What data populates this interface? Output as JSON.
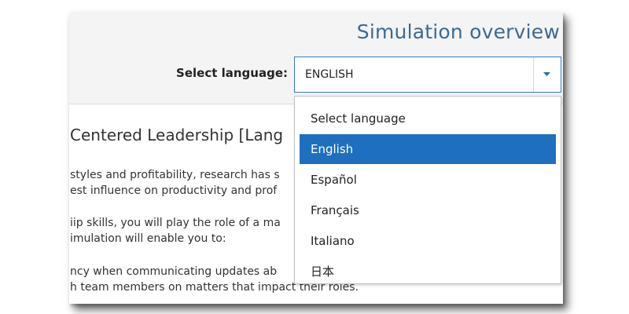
{
  "header": {
    "title": "Simulation overview",
    "language_label": "Select language:",
    "language_value": "ENGLISH"
  },
  "content": {
    "title": "Centered Leadership [Lang",
    "paragraphs": [
      "styles and profitability, research has s",
      "est influence on productivity and prof",
      "iip skills, you will play the role of a ma",
      "imulation will enable you to:",
      "ncy when communicating updates ab",
      "h team members on matters that impact their roles."
    ]
  },
  "dropdown": {
    "options": [
      {
        "label": "Select language",
        "selected": false
      },
      {
        "label": "English",
        "selected": true
      },
      {
        "label": "Español",
        "selected": false
      },
      {
        "label": "Français",
        "selected": false
      },
      {
        "label": "Italiano",
        "selected": false
      },
      {
        "label": "日本",
        "selected": false
      }
    ]
  },
  "colors": {
    "accent": "#1e6fc0",
    "header_title": "#3c6a93",
    "header_bg": "#f4f4f4",
    "select_border": "#3a7cc2"
  },
  "icons": {
    "select_arrow": "caret-down-icon"
  }
}
